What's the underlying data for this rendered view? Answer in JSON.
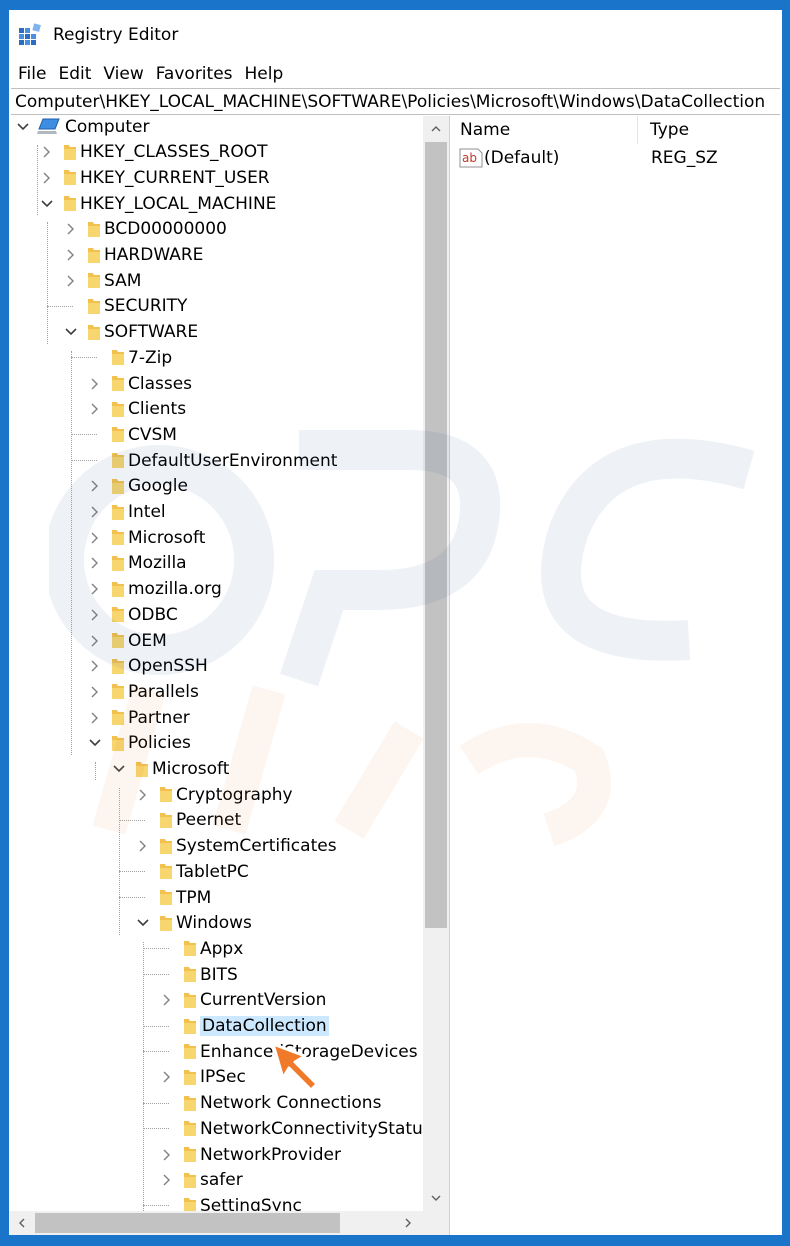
{
  "window": {
    "title": "Registry Editor",
    "app_icon": "registry-editor-icon"
  },
  "menu": [
    "File",
    "Edit",
    "View",
    "Favorites",
    "Help"
  ],
  "address": "Computer\\HKEY_LOCAL_MACHINE\\SOFTWARE\\Policies\\Microsoft\\Windows\\DataCollection",
  "tree": [
    {
      "label": "Computer",
      "level": 0,
      "arrow": "expanded",
      "icon": "computer-icon"
    },
    {
      "label": "HKEY_CLASSES_ROOT",
      "level": 1,
      "arrow": "collapsed"
    },
    {
      "label": "HKEY_CURRENT_USER",
      "level": 1,
      "arrow": "collapsed"
    },
    {
      "label": "HKEY_LOCAL_MACHINE",
      "level": 1,
      "arrow": "expanded"
    },
    {
      "label": "BCD00000000",
      "level": 2,
      "arrow": "collapsed"
    },
    {
      "label": "HARDWARE",
      "level": 2,
      "arrow": "collapsed"
    },
    {
      "label": "SAM",
      "level": 2,
      "arrow": "collapsed"
    },
    {
      "label": "SECURITY",
      "level": 2,
      "arrow": "none"
    },
    {
      "label": "SOFTWARE",
      "level": 2,
      "arrow": "expanded"
    },
    {
      "label": "7-Zip",
      "level": 3,
      "arrow": "none"
    },
    {
      "label": "Classes",
      "level": 3,
      "arrow": "collapsed"
    },
    {
      "label": "Clients",
      "level": 3,
      "arrow": "collapsed"
    },
    {
      "label": "CVSM",
      "level": 3,
      "arrow": "none"
    },
    {
      "label": "DefaultUserEnvironment",
      "level": 3,
      "arrow": "none"
    },
    {
      "label": "Google",
      "level": 3,
      "arrow": "collapsed"
    },
    {
      "label": "Intel",
      "level": 3,
      "arrow": "collapsed"
    },
    {
      "label": "Microsoft",
      "level": 3,
      "arrow": "collapsed"
    },
    {
      "label": "Mozilla",
      "level": 3,
      "arrow": "collapsed"
    },
    {
      "label": "mozilla.org",
      "level": 3,
      "arrow": "collapsed"
    },
    {
      "label": "ODBC",
      "level": 3,
      "arrow": "collapsed"
    },
    {
      "label": "OEM",
      "level": 3,
      "arrow": "collapsed"
    },
    {
      "label": "OpenSSH",
      "level": 3,
      "arrow": "collapsed"
    },
    {
      "label": "Parallels",
      "level": 3,
      "arrow": "collapsed"
    },
    {
      "label": "Partner",
      "level": 3,
      "arrow": "collapsed"
    },
    {
      "label": "Policies",
      "level": 3,
      "arrow": "expanded"
    },
    {
      "label": "Microsoft",
      "level": 4,
      "arrow": "expanded"
    },
    {
      "label": "Cryptography",
      "level": 5,
      "arrow": "collapsed"
    },
    {
      "label": "Peernet",
      "level": 5,
      "arrow": "none"
    },
    {
      "label": "SystemCertificates",
      "level": 5,
      "arrow": "collapsed"
    },
    {
      "label": "TabletPC",
      "level": 5,
      "arrow": "none"
    },
    {
      "label": "TPM",
      "level": 5,
      "arrow": "none"
    },
    {
      "label": "Windows",
      "level": 5,
      "arrow": "expanded"
    },
    {
      "label": "Appx",
      "level": 6,
      "arrow": "none"
    },
    {
      "label": "BITS",
      "level": 6,
      "arrow": "none"
    },
    {
      "label": "CurrentVersion",
      "level": 6,
      "arrow": "collapsed"
    },
    {
      "label": "DataCollection",
      "level": 6,
      "arrow": "none",
      "selected": true
    },
    {
      "label": "EnhancedStorageDevices",
      "level": 6,
      "arrow": "none"
    },
    {
      "label": "IPSec",
      "level": 6,
      "arrow": "collapsed"
    },
    {
      "label": "Network Connections",
      "level": 6,
      "arrow": "none"
    },
    {
      "label": "NetworkConnectivityStatusIndicator",
      "level": 6,
      "arrow": "none"
    },
    {
      "label": "NetworkProvider",
      "level": 6,
      "arrow": "collapsed"
    },
    {
      "label": "safer",
      "level": 6,
      "arrow": "collapsed"
    },
    {
      "label": "SettingSync",
      "level": 6,
      "arrow": "none"
    }
  ],
  "list": {
    "columns": [
      "Name",
      "Type"
    ],
    "rows": [
      {
        "name": "(Default)",
        "type": "REG_SZ",
        "icon": "string-value-icon"
      }
    ]
  },
  "colors": {
    "frame": "#1a74c9",
    "selection": "#cce8ff",
    "folder": "#f2c14e",
    "cursor": "#f07a2a"
  }
}
